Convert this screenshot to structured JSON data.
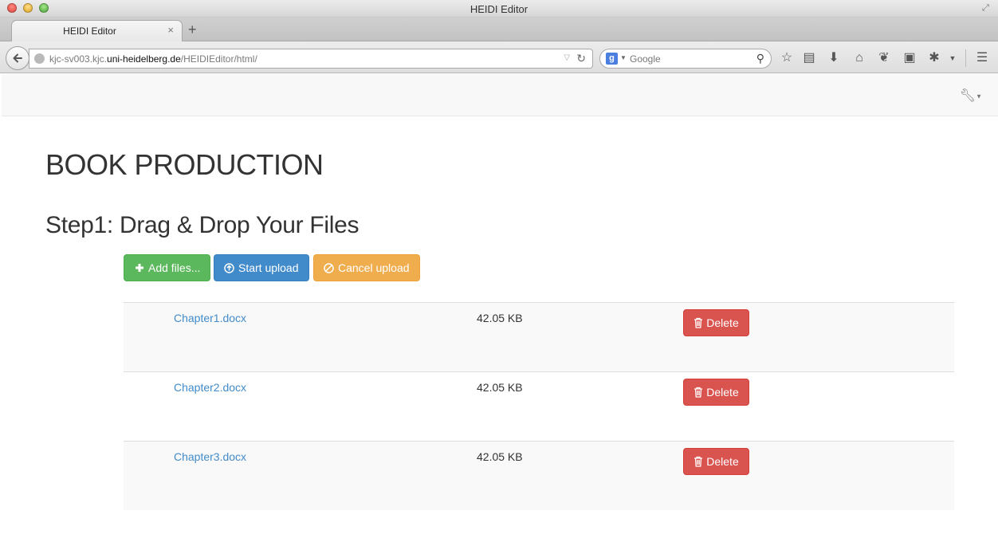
{
  "window": {
    "title": "HEIDI Editor"
  },
  "tabs": [
    {
      "label": "HEIDI Editor"
    }
  ],
  "navbar": {
    "url_prefix": "kjc-sv003.kjc.",
    "url_domain": "uni-heidelberg.de",
    "url_path": "/HEIDIEditor/html/",
    "search_placeholder": "Google",
    "search_engine_letter": "g"
  },
  "page": {
    "title": "BOOK PRODUCTION",
    "step_title": "Step1: Drag & Drop Your Files",
    "buttons": {
      "add": "Add files...",
      "start": "Start upload",
      "cancel": "Cancel upload"
    },
    "files": [
      {
        "name": "Chapter1.docx",
        "size": "42.05 KB",
        "delete_label": "Delete"
      },
      {
        "name": "Chapter2.docx",
        "size": "42.05 KB",
        "delete_label": "Delete"
      },
      {
        "name": "Chapter3.docx",
        "size": "42.05 KB",
        "delete_label": "Delete"
      }
    ]
  },
  "colors": {
    "success": "#5cb85c",
    "primary": "#428bca",
    "warning": "#f0ad4e",
    "danger": "#d9534f",
    "link": "#428bca"
  }
}
